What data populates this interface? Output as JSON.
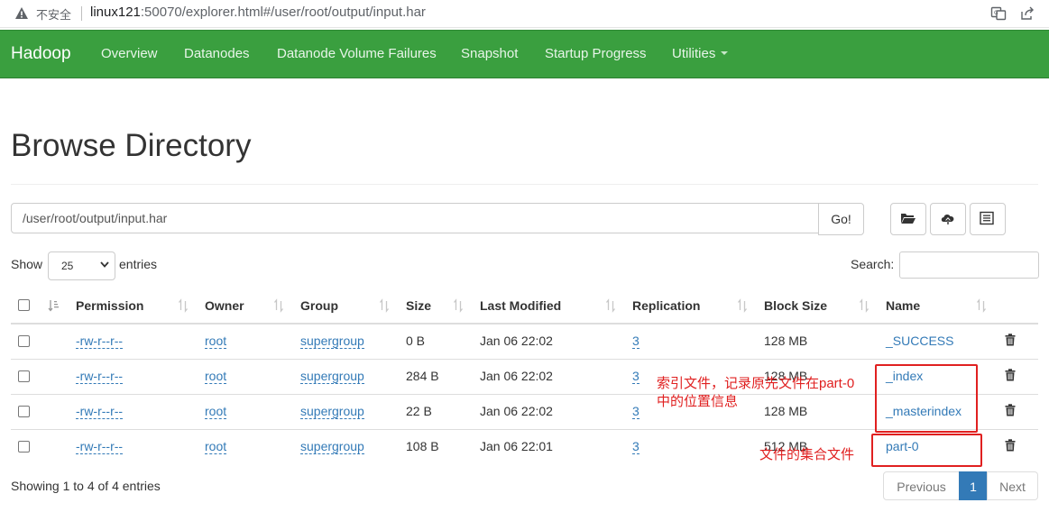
{
  "browser": {
    "insecure_label": "不安全",
    "url_host": "linux121",
    "url_rest": ":50070/explorer.html#/user/root/output/input.har"
  },
  "navbar": {
    "brand": "Hadoop",
    "items": [
      {
        "label": "Overview"
      },
      {
        "label": "Datanodes"
      },
      {
        "label": "Datanode Volume Failures"
      },
      {
        "label": "Snapshot"
      },
      {
        "label": "Startup Progress"
      },
      {
        "label": "Utilities"
      }
    ],
    "color": "#3a9f3f"
  },
  "page": {
    "title": "Browse Directory",
    "path_value": "/user/root/output/input.har",
    "go_label": "Go!"
  },
  "table_controls": {
    "show_label": "Show",
    "entries_value": "25",
    "entries_label": "entries",
    "search_label": "Search:"
  },
  "table": {
    "columns": [
      "Permission",
      "Owner",
      "Group",
      "Size",
      "Last Modified",
      "Replication",
      "Block Size",
      "Name"
    ],
    "rows": [
      {
        "permission": "-rw-r--r--",
        "owner": "root",
        "group": "supergroup",
        "size": "0 B",
        "modified": "Jan 06 22:02",
        "replication": "3",
        "block_size": "128 MB",
        "name": "_SUCCESS"
      },
      {
        "permission": "-rw-r--r--",
        "owner": "root",
        "group": "supergroup",
        "size": "284 B",
        "modified": "Jan 06 22:02",
        "replication": "3",
        "block_size": "128 MB",
        "name": "_index"
      },
      {
        "permission": "-rw-r--r--",
        "owner": "root",
        "group": "supergroup",
        "size": "22 B",
        "modified": "Jan 06 22:02",
        "replication": "3",
        "block_size": "128 MB",
        "name": "_masterindex"
      },
      {
        "permission": "-rw-r--r--",
        "owner": "root",
        "group": "supergroup",
        "size": "108 B",
        "modified": "Jan 06 22:01",
        "replication": "3",
        "block_size": "512 MB",
        "name": "part-0"
      }
    ]
  },
  "footer": {
    "info": "Showing 1 to 4 of 4 entries",
    "previous": "Previous",
    "page": "1",
    "next": "Next"
  },
  "annotations": {
    "index_note_line1": "索引文件，记录原先文件在part-0",
    "index_note_line2": "中的位置信息",
    "part_note": "文件的集合文件",
    "color": "#e02020"
  }
}
